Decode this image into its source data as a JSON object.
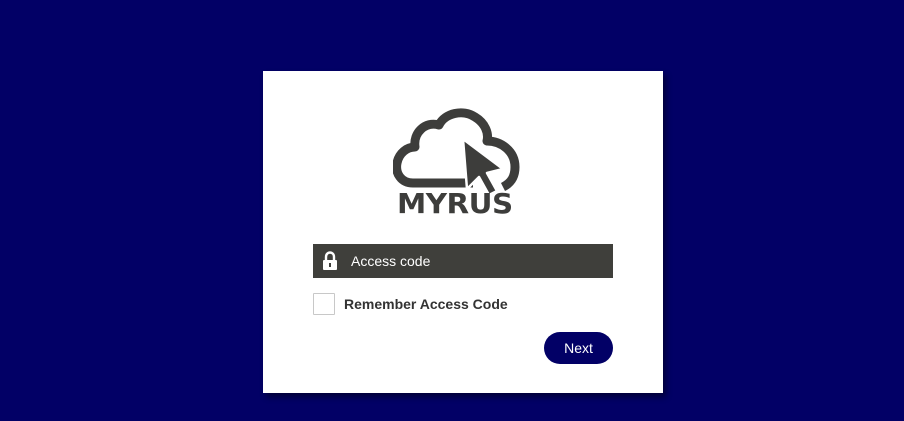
{
  "logo": {
    "text": "MYRUS",
    "icon": "cloud-cursor-icon",
    "color": "#3d3d3b"
  },
  "login": {
    "access_code_placeholder": "Access code",
    "access_code_value": "",
    "remember_label": "Remember Access Code",
    "remember_checked": false,
    "next_label": "Next"
  },
  "colors": {
    "background": "#020066",
    "card": "#ffffff",
    "field": "#3f3f3b",
    "button": "#020066"
  }
}
